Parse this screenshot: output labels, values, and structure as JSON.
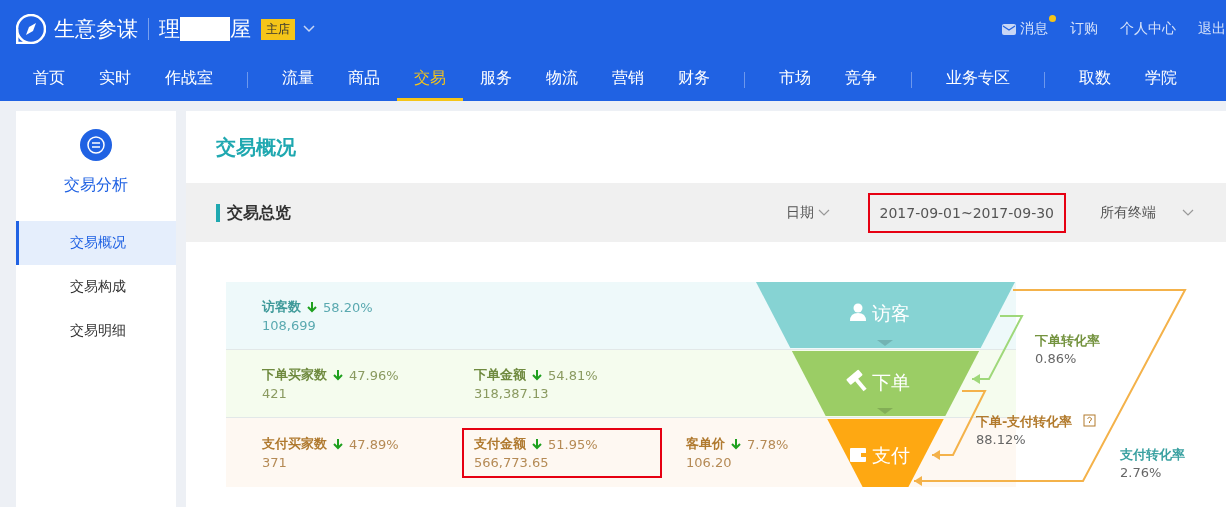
{
  "header": {
    "app_name": "生意参谋",
    "shop_name_parts": [
      "理",
      "屋"
    ],
    "shop_badge": "主店",
    "links": [
      {
        "label": "消息",
        "kind": "messages",
        "unread": true
      },
      {
        "label": "订购",
        "kind": "plain"
      },
      {
        "label": "个人中心",
        "kind": "plain"
      },
      {
        "label": "退出",
        "kind": "plain"
      }
    ]
  },
  "nav_groups": [
    [
      {
        "label": "首页",
        "selected": false
      },
      {
        "label": "实时",
        "selected": false
      },
      {
        "label": "作战室",
        "selected": false
      }
    ],
    [
      {
        "label": "流量",
        "selected": false
      },
      {
        "label": "商品",
        "selected": false
      },
      {
        "label": "交易",
        "selected": true
      },
      {
        "label": "服务",
        "selected": false
      },
      {
        "label": "物流",
        "selected": false
      },
      {
        "label": "营销",
        "selected": false
      },
      {
        "label": "财务",
        "selected": false
      }
    ],
    [
      {
        "label": "市场",
        "selected": false
      },
      {
        "label": "竞争",
        "selected": false
      }
    ],
    [
      {
        "label": "业务专区",
        "selected": false
      }
    ],
    [
      {
        "label": "取数",
        "selected": false
      },
      {
        "label": "学院",
        "selected": false
      }
    ]
  ],
  "sidebar": {
    "title": "交易分析",
    "items": [
      {
        "label": "交易概况",
        "selected": true
      },
      {
        "label": "交易构成",
        "selected": false
      },
      {
        "label": "交易明细",
        "selected": false
      }
    ]
  },
  "page_title": "交易概况",
  "section": {
    "title": "交易总览",
    "date_label": "日期",
    "date_range": {
      "text": "2017-09-01~2017-09-30",
      "highlighted": true
    },
    "terminal": "所有终端"
  },
  "metric_rows": [
    {
      "metrics": [
        {
          "label": "访客数",
          "falling": true,
          "change": "58.20%",
          "value": "108,699",
          "highlighted": false
        }
      ]
    },
    {
      "metrics": [
        {
          "label": "下单买家数",
          "falling": true,
          "change": "47.96%",
          "value": "421",
          "highlighted": false
        },
        {
          "label": "下单金额",
          "falling": true,
          "change": "54.81%",
          "value": "318,387.13",
          "highlighted": false
        }
      ]
    },
    {
      "metrics": [
        {
          "label": "支付买家数",
          "falling": true,
          "change": "47.89%",
          "value": "371",
          "highlighted": false
        },
        {
          "label": "支付金额",
          "falling": true,
          "change": "51.95%",
          "value": "566,773.65",
          "highlighted": true
        },
        {
          "label": "客单价",
          "falling": true,
          "change": "7.78%",
          "value": "106.20",
          "highlighted": false
        }
      ]
    }
  ],
  "funnel": {
    "stages": [
      {
        "label": "访客",
        "kind": "visitor",
        "color": "#86d3d3"
      },
      {
        "label": "下单",
        "kind": "order",
        "color": "#9bcd65"
      },
      {
        "label": "支付",
        "kind": "payment",
        "color": "#fea812"
      }
    ],
    "rates": [
      {
        "label": "下单转化率",
        "value": "0.86%",
        "kind": "visit-order"
      },
      {
        "label": "下单-支付转化率",
        "value": "88.12%",
        "kind": "order-pay",
        "help": true
      },
      {
        "label": "支付转化率",
        "value": "2.76%",
        "kind": "visit-pay"
      }
    ]
  }
}
